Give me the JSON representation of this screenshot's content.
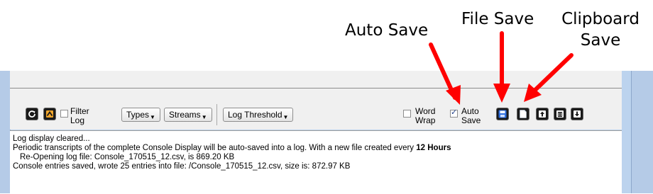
{
  "annotations": {
    "auto_save": "Auto Save",
    "file_save": "File Save",
    "clipboard_save_line1": "Clipboard",
    "clipboard_save_line2": "Save",
    "arrow_color": "#ff0000"
  },
  "toolbar": {
    "filter_log_line1": "Filter",
    "filter_log_line2": "Log",
    "filter_log_checked": false,
    "types_label": "Types",
    "streams_label": "Streams",
    "log_threshold_label": "Log Threshold",
    "word_wrap_line1": "Word",
    "word_wrap_line2": "Wrap",
    "word_wrap_checked": false,
    "auto_save_line1": "Auto",
    "auto_save_line2": "Save",
    "auto_save_checked": true
  },
  "log": {
    "line1": "Log display cleared...",
    "line2_prefix": "Periodic transcripts of the complete Console Display will be auto-saved into a log. With a new file created every ",
    "line2_bold": "12 Hours",
    "line3": "Re-Opening log file:  Console_170515_12.csv, is 869.20 KB",
    "line4": "Console entries saved, wrote 25 entries into file: /Console_170515_12.csv, size is: 872.97 KB"
  },
  "icons": [
    "refresh-icon",
    "scroll-top-icon",
    "file-save-icon",
    "clipboard-save-icon",
    "upload-icon",
    "trash-icon",
    "download-icon"
  ]
}
